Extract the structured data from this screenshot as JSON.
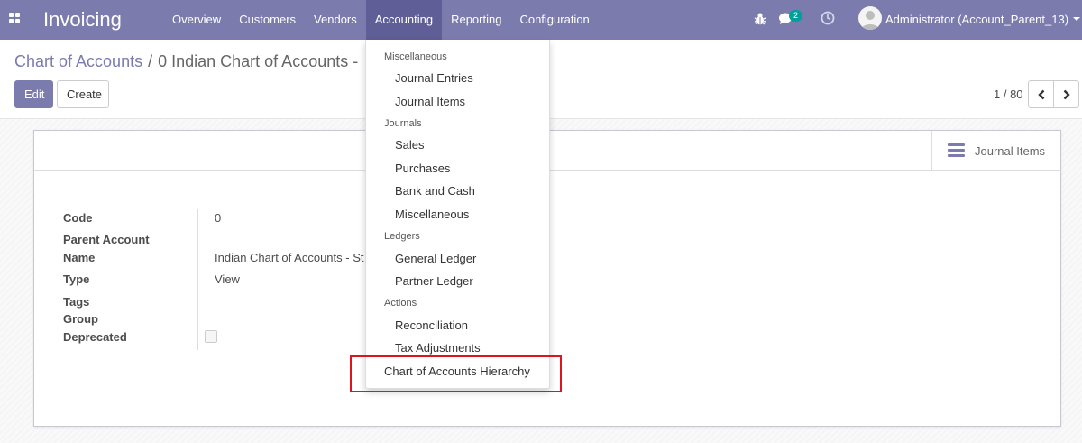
{
  "app": {
    "brand": "Invoicing",
    "menu": [
      "Overview",
      "Customers",
      "Vendors",
      "Accounting",
      "Reporting",
      "Configuration"
    ],
    "active_menu": "Accounting",
    "chat_count": "2",
    "user": "Administrator (Account_Parent_13)"
  },
  "breadcrumb": {
    "parent": "Chart of Accounts",
    "separator": "/",
    "current": "0 Indian Chart of Accounts -"
  },
  "buttons": {
    "edit": "Edit",
    "create": "Create"
  },
  "pager": {
    "value": "1 / 80"
  },
  "form": {
    "stat_button": "Journal Items",
    "fields": [
      {
        "label": "Code",
        "value": "0"
      },
      {
        "label": "Parent Account",
        "value": ""
      },
      {
        "label": "Name",
        "value": "Indian Chart of Accounts - St"
      },
      {
        "label": "Type",
        "value": "View"
      },
      {
        "label": "Tags",
        "value": ""
      },
      {
        "label": "Group",
        "value": ""
      },
      {
        "label": "Deprecated",
        "value": ""
      }
    ],
    "deprecated_checked": false
  },
  "dropdown": {
    "sections": [
      {
        "header": "Miscellaneous",
        "items": [
          "Journal Entries",
          "Journal Items"
        ]
      },
      {
        "header": "Journals",
        "items": [
          "Sales",
          "Purchases",
          "Bank and Cash",
          "Miscellaneous"
        ]
      },
      {
        "header": "Ledgers",
        "items": [
          "General Ledger",
          "Partner Ledger"
        ]
      },
      {
        "header": "Actions",
        "items": [
          "Reconciliation",
          "Tax Adjustments"
        ]
      }
    ],
    "top_item": "Chart of Accounts Hierarchy"
  },
  "colors": {
    "navbar": "#7c7bad",
    "navbar_active": "#5f5e97",
    "highlight": "#e0141e",
    "badge": "#00a09d"
  },
  "icons": [
    "apps-grid-icon",
    "bug-icon",
    "chat-icon",
    "clock-icon",
    "user-avatar-icon",
    "caret-down-icon",
    "chevron-left-icon",
    "chevron-right-icon",
    "list-icon"
  ]
}
